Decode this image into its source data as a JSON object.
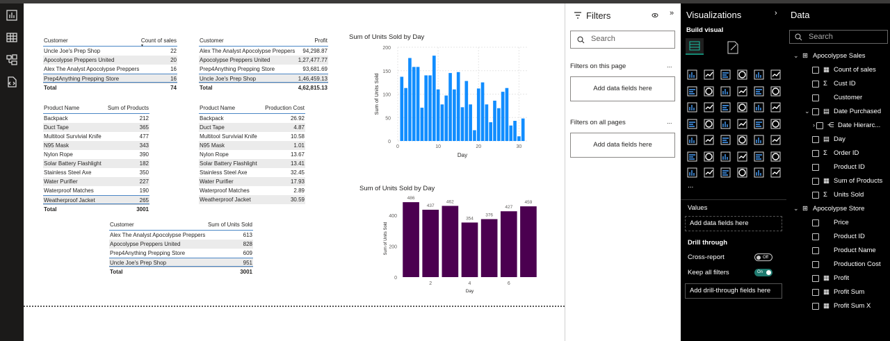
{
  "rail": {
    "icons": [
      "report-view-icon",
      "table-view-icon",
      "model-view-icon",
      "dax-query-icon"
    ]
  },
  "tables": {
    "count_of_sales": {
      "headers": [
        "Customer",
        "Count of sales"
      ],
      "rows": [
        [
          "Uncle Joe's Prep Shop",
          "22"
        ],
        [
          "Apocolypse Preppers United",
          "20"
        ],
        [
          "Alex The Analyst Apocolypse Preppers",
          "16"
        ],
        [
          "Prep4Anything Prepping Store",
          "16"
        ]
      ],
      "total": [
        "Total",
        "74"
      ]
    },
    "profit": {
      "headers": [
        "Customer",
        "Profit"
      ],
      "rows": [
        [
          "Alex The Analyst Apocolypse Preppers",
          "94,298.87"
        ],
        [
          "Apocolypse Preppers United",
          "1,27,477.77"
        ],
        [
          "Prep4Anything Prepping Store",
          "93,681.69"
        ],
        [
          "Uncle Joe's Prep Shop",
          "1,46,459.13"
        ]
      ],
      "total": [
        "Total",
        "4,62,815.13"
      ]
    },
    "sum_of_products": {
      "headers": [
        "Product Name",
        "Sum of Products"
      ],
      "rows": [
        [
          "Backpack",
          "212"
        ],
        [
          "Duct Tape",
          "365"
        ],
        [
          "Multitool Survivial Knife",
          "477"
        ],
        [
          "N95 Mask",
          "343"
        ],
        [
          "Nylon Rope",
          "390"
        ],
        [
          "Solar Battery Flashlight",
          "182"
        ],
        [
          "Stainless Steel Axe",
          "350"
        ],
        [
          "Water Purifier",
          "227"
        ],
        [
          "Waterproof Matches",
          "190"
        ],
        [
          "Weatherproof Jacket",
          "265"
        ]
      ],
      "total": [
        "Total",
        "3001"
      ]
    },
    "production_cost": {
      "headers": [
        "Product Name",
        "Production Cost"
      ],
      "rows": [
        [
          "Backpack",
          "26.92"
        ],
        [
          "Duct Tape",
          "4.87"
        ],
        [
          "Multitool Survivial Knife",
          "10.58"
        ],
        [
          "N95 Mask",
          "1.01"
        ],
        [
          "Nylon Rope",
          "13.67"
        ],
        [
          "Solar Battery Flashlight",
          "13.41"
        ],
        [
          "Stainless Steel Axe",
          "32.45"
        ],
        [
          "Water Purifier",
          "17.93"
        ],
        [
          "Waterproof Matches",
          "2.89"
        ],
        [
          "Weatherproof Jacket",
          "30.59"
        ]
      ]
    },
    "units_sold": {
      "headers": [
        "Customer",
        "Sum of Units Sold"
      ],
      "rows": [
        [
          "Alex The Analyst Apocolypse Preppers",
          "613"
        ],
        [
          "Apocolypse Preppers United",
          "828"
        ],
        [
          "Prep4Anything Prepping Store",
          "609"
        ],
        [
          "Uncle Joe's Prep Shop",
          "951"
        ]
      ],
      "total": [
        "Total",
        "3001"
      ]
    }
  },
  "chart_data": [
    {
      "type": "bar",
      "title": "Sum of Units Sold by Day",
      "xlabel": "Day",
      "ylabel": "Sum of Units Sold",
      "ylim": [
        0,
        200
      ],
      "yticks": [
        0,
        50,
        100,
        150,
        200
      ],
      "xticks": [
        0,
        10,
        20,
        30
      ],
      "color": "#118dff",
      "grid": true,
      "x": [
        1,
        2,
        3,
        4,
        5,
        6,
        7,
        8,
        9,
        10,
        11,
        12,
        13,
        14,
        15,
        16,
        17,
        18,
        19,
        20,
        21,
        22,
        23,
        24,
        25,
        26,
        27,
        28,
        29,
        30,
        31
      ],
      "values": [
        137,
        113,
        177,
        158,
        158,
        71,
        140,
        140,
        182,
        110,
        78,
        97,
        145,
        110,
        147,
        72,
        128,
        78,
        23,
        112,
        125,
        78,
        40,
        86,
        70,
        105,
        113,
        33,
        43,
        10,
        48
      ]
    },
    {
      "type": "bar",
      "title": "Sum of Units Sold by Day",
      "xlabel": "Day",
      "ylabel": "Sum of Units Sold",
      "ylim": [
        0,
        500
      ],
      "yticks": [
        0,
        200,
        400
      ],
      "xticks": [
        2,
        4,
        6
      ],
      "color": "#4b0050",
      "x": [
        1,
        2,
        3,
        4,
        5,
        6,
        7
      ],
      "values": [
        486,
        437,
        462,
        354,
        376,
        427,
        459
      ]
    }
  ],
  "filters": {
    "title": "Filters",
    "search_placeholder": "Search",
    "on_this_page": "Filters on this page",
    "on_all_pages": "Filters on all pages",
    "add_fields": "Add data fields here",
    "more": "..."
  },
  "visualizations": {
    "title": "Visualizations",
    "build_visual": "Build visual",
    "values_label": "Values",
    "values_drop": "Add data fields here",
    "drill_through": "Drill through",
    "cross_report": "Cross-report",
    "cross_report_state": "Off",
    "keep_all_filters": "Keep all filters",
    "keep_all_filters_state": "On",
    "drill_drop": "Add drill-through fields here",
    "more": "...",
    "colors": {
      "accent_on": "#1f7a6f",
      "toolbar_selected": "#138a75"
    }
  },
  "data": {
    "title": "Data",
    "search_placeholder": "Search",
    "tables": [
      {
        "name": "Apocolypse Sales",
        "fields": [
          {
            "label": "Count of sales",
            "icon": "calculator-icon"
          },
          {
            "label": "Cust ID",
            "icon": "sigma-icon"
          },
          {
            "label": "Customer",
            "icon": ""
          },
          {
            "label": "Date Purchased",
            "icon": "calendar-icon"
          },
          {
            "label": "Date Hierarc...",
            "icon": "hierarchy-icon"
          },
          {
            "label": "Day",
            "icon": "calendar-icon"
          },
          {
            "label": "Order ID",
            "icon": "sigma-icon"
          },
          {
            "label": "Product ID",
            "icon": ""
          },
          {
            "label": "Sum of Products",
            "icon": "calculator-icon"
          },
          {
            "label": "Units Sold",
            "icon": "sigma-icon"
          }
        ]
      },
      {
        "name": "Apocolypse Store",
        "fields": [
          {
            "label": "Price",
            "icon": ""
          },
          {
            "label": "Product ID",
            "icon": ""
          },
          {
            "label": "Product Name",
            "icon": ""
          },
          {
            "label": "Production Cost",
            "icon": ""
          },
          {
            "label": "Profit",
            "icon": "calculator-icon"
          },
          {
            "label": "Profit Sum",
            "icon": "calculator-icon"
          },
          {
            "label": "Profit Sum X",
            "icon": "calculator-icon"
          }
        ]
      }
    ]
  }
}
